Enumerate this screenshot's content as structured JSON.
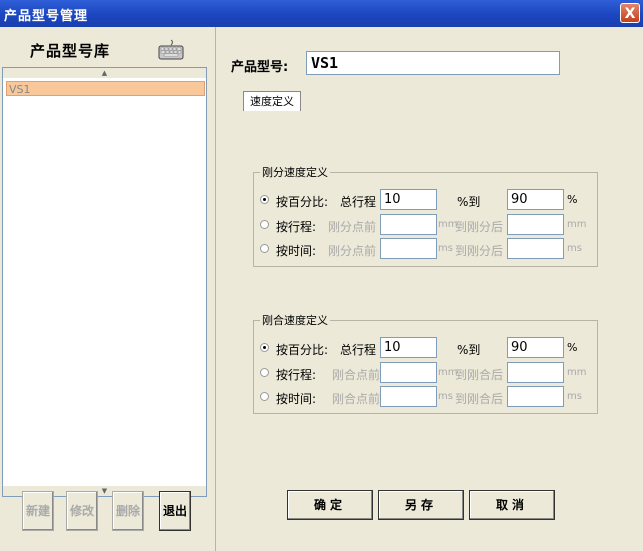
{
  "window": {
    "title": "产品型号管理",
    "close_glyph": "X"
  },
  "library": {
    "title": "产品型号库",
    "items": [
      "VS1"
    ],
    "buttons": {
      "new": "新建",
      "edit": "修改",
      "delete": "删除",
      "exit": "退出"
    }
  },
  "model": {
    "label": "产品型号:",
    "value": "VS1"
  },
  "tabs": [
    "速度定义"
  ],
  "open_speed": {
    "title": "刚分速度定义",
    "rows": [
      {
        "label": "按百分比:",
        "start_hint": "总行程",
        "start_value": "10",
        "mid": "%到",
        "end_value": "90",
        "unit": "%",
        "checked": true,
        "enabled": true
      },
      {
        "label": "按行程:",
        "start_hint": "刚分点前",
        "start_value": "",
        "unit1": "mm",
        "mid": "到刚分后",
        "end_value": "",
        "unit": "mm",
        "checked": false,
        "enabled": false
      },
      {
        "label": "按时间:",
        "start_hint": "刚分点前",
        "start_value": "",
        "unit1": "ms",
        "mid": "到刚分后",
        "end_value": "",
        "unit": "ms",
        "checked": false,
        "enabled": false
      }
    ]
  },
  "close_speed": {
    "title": "刚合速度定义",
    "rows": [
      {
        "label": "按百分比:",
        "start_hint": "总行程",
        "start_value": "10",
        "mid": "%到",
        "end_value": "90",
        "unit": "%",
        "checked": true,
        "enabled": true
      },
      {
        "label": "按行程:",
        "start_hint": "刚合点前",
        "start_value": "",
        "unit1": "mm",
        "mid": "到刚合后",
        "end_value": "",
        "unit": "mm",
        "checked": false,
        "enabled": false
      },
      {
        "label": "按时间:",
        "start_hint": "刚合点前",
        "start_value": "",
        "unit1": "ms",
        "mid": "到刚合后",
        "end_value": "",
        "unit": "ms",
        "checked": false,
        "enabled": false
      }
    ]
  },
  "actions": {
    "ok": "确定",
    "save_as": "另存",
    "cancel": "取消"
  },
  "icons": {
    "keyboard": "keyboard-icon",
    "radio": "radio-icon"
  }
}
